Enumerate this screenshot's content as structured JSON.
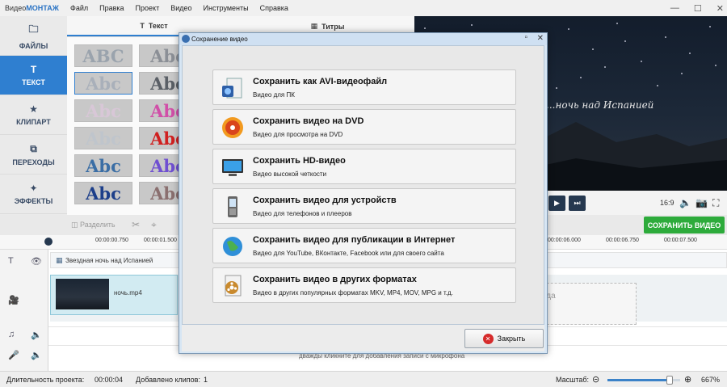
{
  "app": {
    "title_prefix": "Видео",
    "title_brand": "МОНТАЖ",
    "menu": [
      "Файл",
      "Правка",
      "Проект",
      "Видео",
      "Инструменты",
      "Справка"
    ]
  },
  "leftnav": {
    "items": [
      {
        "label": "ФАЙЛЫ",
        "icon": "folder-icon",
        "active": false
      },
      {
        "label": "ТЕКСТ",
        "icon": "text-icon",
        "active": true
      },
      {
        "label": "КЛИПАРТ",
        "icon": "star-icon",
        "active": false
      },
      {
        "label": "ПЕРЕХОДЫ",
        "icon": "transitions-icon",
        "active": false
      },
      {
        "label": "ЭФФЕКТЫ",
        "icon": "magic-wand-icon",
        "active": false
      }
    ]
  },
  "tabs": [
    {
      "label": "Текст",
      "active": true
    },
    {
      "label": "Титры",
      "active": false
    }
  ],
  "style_tiles": [
    {
      "text": "ABC",
      "color": "#9aa3ad"
    },
    {
      "text": "Abc",
      "color": "#8b8f96"
    },
    {
      "text": "Abc",
      "color": "#a9b0ba"
    },
    {
      "text": "Abc",
      "color": "#5a5f66"
    },
    {
      "text": "Abc",
      "color": "#d8c7d7"
    },
    {
      "text": "Abc",
      "color": "#d14fa8"
    },
    {
      "text": "Abc",
      "color": "#bfc5cc"
    },
    {
      "text": "Abc",
      "color": "#d02020"
    },
    {
      "text": "Abc",
      "color": "#3b6ea5"
    },
    {
      "text": "Abc",
      "color": "#6f4fd1"
    },
    {
      "text": "Abc",
      "color": "#1d3f8a"
    },
    {
      "text": "Abc",
      "color": "#8a6f6f"
    }
  ],
  "preview": {
    "caption": "...ночь над Испанией"
  },
  "player": {
    "ratio": "16:9"
  },
  "toolbar": {
    "split_label": "Разделить",
    "save_video_label": "СОХРАНИТЬ ВИДЕО"
  },
  "ruler": {
    "ticks": [
      "00:00:00.750",
      "00:00:01.500",
      "00:00:06.000",
      "00:00:06.750",
      "00:00:07.500"
    ]
  },
  "timeline": {
    "title_clip": "Звездная ночь над Испанией",
    "video_clip": "ночь.mp4",
    "drop_zone_text": "юда\nо",
    "mic_hint": "дважды кликните для добавления записи с микрофона"
  },
  "statusbar": {
    "duration_label": "Длительность проекта:",
    "duration_value": "00:00:04",
    "clips_label": "Добавлено клипов:",
    "clips_value": "1",
    "zoom_label": "Масштаб:",
    "zoom_value": "667%",
    "zoom_level": 0.85
  },
  "dialog": {
    "title": "Сохранение видео",
    "options": [
      {
        "title": "Сохранить как AVI-видеофайл",
        "desc": "Видео для ПК",
        "icon": "avi-file-icon"
      },
      {
        "title": "Сохранить видео на DVD",
        "desc": "Видео для просмотра на DVD",
        "icon": "dvd-disc-icon"
      },
      {
        "title": "Сохранить HD-видео",
        "desc": "Видео высокой четкости",
        "icon": "hd-monitor-icon"
      },
      {
        "title": "Сохранить видео для устройств",
        "desc": "Видео для телефонов и плееров",
        "icon": "phone-device-icon"
      },
      {
        "title": "Сохранить видео для публикации в Интернет",
        "desc": "Видео для YouTube, ВКонтакте, Facebook или для своего сайта",
        "icon": "globe-internet-icon"
      },
      {
        "title": "Сохранить видео в других форматах",
        "desc": "Видео в других популярных форматах MKV, MP4, MOV, MPG и т.д.",
        "icon": "film-reel-icon"
      }
    ],
    "close_label": "Закрыть"
  }
}
